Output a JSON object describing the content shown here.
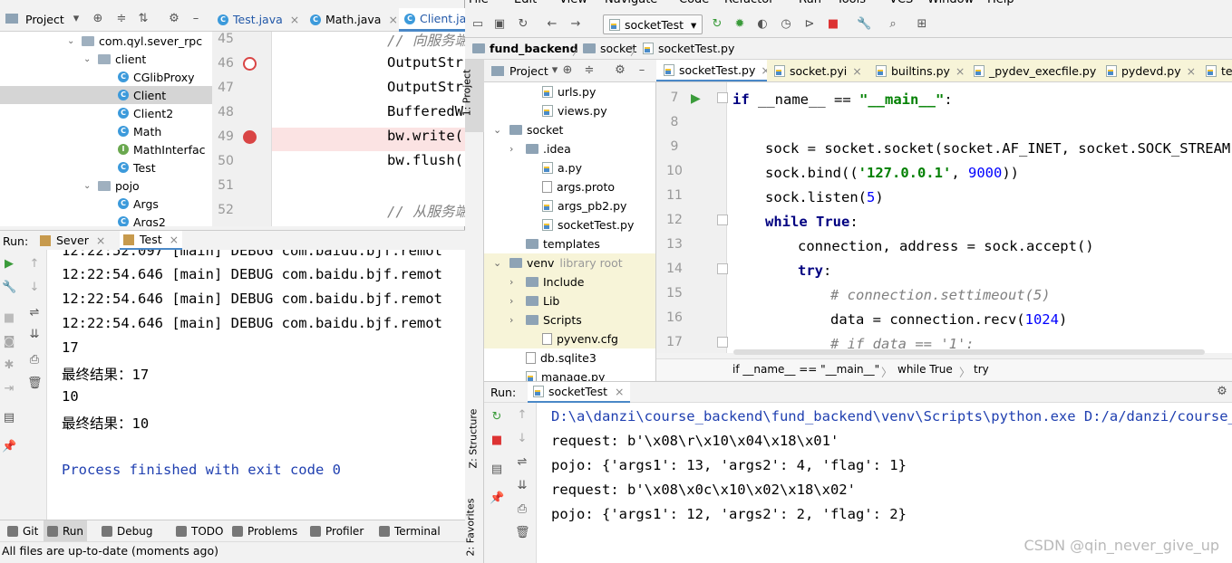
{
  "left": {
    "project_label": "Project",
    "tabs": [
      {
        "label": "Test.java"
      },
      {
        "label": "Math.java"
      },
      {
        "label": "Client.ja"
      }
    ],
    "tree": [
      {
        "text": "com.qyl.sever_rpc",
        "type": "pkg",
        "indent": 78,
        "arrow": "v"
      },
      {
        "text": "client",
        "type": "pkg",
        "indent": 96,
        "arrow": "v"
      },
      {
        "text": "CGlibProxy",
        "type": "C",
        "indent": 130
      },
      {
        "text": "Client",
        "type": "C",
        "indent": 130,
        "selected": true
      },
      {
        "text": "Client2",
        "type": "C",
        "indent": 130
      },
      {
        "text": "Math",
        "type": "C",
        "indent": 130
      },
      {
        "text": "MathInterfac",
        "type": "I",
        "indent": 130
      },
      {
        "text": "Test",
        "type": "C",
        "indent": 130
      },
      {
        "text": "pojo",
        "type": "pkg",
        "indent": 96,
        "arrow": "v"
      },
      {
        "text": "Args",
        "type": "C",
        "indent": 130
      },
      {
        "text": "Args2",
        "type": "C",
        "indent": 130
      }
    ],
    "code_lines": [
      {
        "n": "45",
        "text": "// 向服务端"
      },
      {
        "n": "46",
        "text": "OutputStr"
      },
      {
        "n": "47",
        "text": "OutputStr"
      },
      {
        "n": "48",
        "text": "BufferedW"
      },
      {
        "n": "49",
        "text": "bw.write("
      },
      {
        "n": "50",
        "text": "bw.flush("
      },
      {
        "n": "51",
        "text": ""
      },
      {
        "n": "52",
        "text": "// 从服务端"
      }
    ],
    "run_label": "Run:",
    "run_tabs": [
      {
        "label": "Sever"
      },
      {
        "label": "Test"
      }
    ],
    "console": [
      {
        "text": "12:22:54.646 [main] DEBUG com.baidu.bjf.remot",
        "cls": ""
      },
      {
        "text": "12:22:54.646 [main] DEBUG com.baidu.bjf.remot",
        "cls": ""
      },
      {
        "text": "12:22:54.646 [main] DEBUG com.baidu.bjf.remot",
        "cls": ""
      },
      {
        "text": "17",
        "cls": ""
      },
      {
        "text": "最终结果：17",
        "cls": ""
      },
      {
        "text": "10",
        "cls": ""
      },
      {
        "text": "最终结果：10",
        "cls": ""
      },
      {
        "text": "",
        "cls": ""
      },
      {
        "text": "Process finished with exit code 0",
        "cls": "fin"
      }
    ],
    "console_top_partial": "12:22:52.097 [main] DEBUG com.baidu.bjf.remot",
    "bottom_tabs": [
      {
        "label": "Git",
        "icon": "git-icon"
      },
      {
        "label": "Run",
        "icon": "run-icon",
        "active": true
      },
      {
        "label": "Debug",
        "icon": "debug-icon"
      },
      {
        "label": "TODO",
        "icon": "todo-icon"
      },
      {
        "label": "Problems",
        "icon": "problems-icon"
      },
      {
        "label": "Profiler",
        "icon": "profiler-icon"
      },
      {
        "label": "Terminal",
        "icon": "terminal-icon"
      }
    ],
    "status": "All files are up-to-date (moments ago)"
  },
  "right": {
    "menu": [
      "File",
      "Edit",
      "View",
      "Navigate",
      "Code",
      "Refactor",
      "Run",
      "Tools",
      "VCS",
      "Window",
      "Help"
    ],
    "run_config": "socketTest",
    "breadcrumb": [
      "fund_backend",
      "socket",
      "socketTest.py"
    ],
    "project_label": "Project",
    "side_tabs": [
      "1: Project",
      "Z: Structure",
      "2: Favorites"
    ],
    "editor_tabs": [
      {
        "label": "socketTest.py",
        "active": true
      },
      {
        "label": "socket.pyi"
      },
      {
        "label": "builtins.py"
      },
      {
        "label": "_pydev_execfile.py"
      },
      {
        "label": "pydevd.py"
      },
      {
        "label": "te"
      }
    ],
    "tree": [
      {
        "text": "urls.py",
        "type": "py",
        "indent": 64
      },
      {
        "text": "views.py",
        "type": "py",
        "indent": 64
      },
      {
        "text": "socket",
        "type": "folder",
        "indent": 28,
        "arrow": "v"
      },
      {
        "text": ".idea",
        "type": "folder",
        "indent": 46,
        "arrow": ">"
      },
      {
        "text": "a.py",
        "type": "py",
        "indent": 64
      },
      {
        "text": "args.proto",
        "type": "file",
        "indent": 64
      },
      {
        "text": "args_pb2.py",
        "type": "py",
        "indent": 64
      },
      {
        "text": "socketTest.py",
        "type": "py",
        "indent": 64
      },
      {
        "text": "templates",
        "type": "folder",
        "indent": 46
      },
      {
        "text": "venv",
        "type": "folder",
        "indent": 28,
        "arrow": "v",
        "extra": "library root",
        "hl": true
      },
      {
        "text": "Include",
        "type": "folder",
        "indent": 46,
        "arrow": ">",
        "hl": true
      },
      {
        "text": "Lib",
        "type": "folder",
        "indent": 46,
        "arrow": ">",
        "hl": true
      },
      {
        "text": "Scripts",
        "type": "folder",
        "indent": 46,
        "arrow": ">",
        "hl": true
      },
      {
        "text": "pyvenv.cfg",
        "type": "file",
        "indent": 64,
        "hl": true
      },
      {
        "text": "db.sqlite3",
        "type": "file",
        "indent": 46
      },
      {
        "text": "manage.py",
        "type": "py",
        "indent": 46
      }
    ],
    "code_gutter": [
      "7",
      "8",
      "9",
      "10",
      "11",
      "12",
      "13",
      "14",
      "15",
      "16",
      "17"
    ],
    "code_crumbs": [
      "if __name__ == \"__main__\"",
      "while True",
      "try"
    ],
    "run_label": "Run:",
    "run_tab": "socketTest",
    "console": [
      {
        "text": "D:\\a\\danzi\\course_backend\\fund_backend\\venv\\Scripts\\python.exe D:/a/danzi/course_backend",
        "cls": "path"
      },
      {
        "text": "request: b'\\x08\\r\\x10\\x04\\x18\\x01'",
        "cls": ""
      },
      {
        "text": "pojo: {'args1': 13, 'args2': 4, 'flag': 1}",
        "cls": ""
      },
      {
        "text": "request: b'\\x08\\x0c\\x10\\x02\\x18\\x02'",
        "cls": ""
      },
      {
        "text": "pojo: {'args1': 12, 'args2': 2, 'flag': 2}",
        "cls": ""
      }
    ],
    "watermark": "CSDN @qin_never_give_up"
  }
}
